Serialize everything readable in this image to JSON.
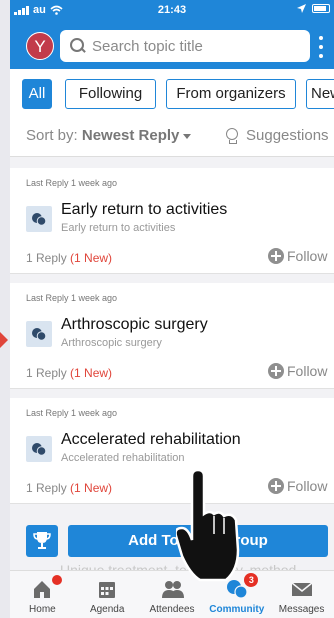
{
  "status": {
    "carrier": "au",
    "time": "21:43"
  },
  "header": {
    "avatar_letter": "Y",
    "search_placeholder": "Search topic title"
  },
  "filters": [
    "All",
    "Following",
    "From organizers",
    "New"
  ],
  "sort": {
    "prefix": "Sort by:",
    "value": "Newest Reply",
    "suggestions": "Suggestions"
  },
  "topics": [
    {
      "meta": "Last Reply 1 week ago",
      "title": "Early return to activities",
      "subtitle": "Early return to activities",
      "replies": "1 Reply",
      "new": "(1 New)",
      "follow": "Follow"
    },
    {
      "meta": "Last Reply 1 week ago",
      "title": "Arthroscopic surgery",
      "subtitle": "Arthroscopic surgery",
      "replies": "1 Reply",
      "new": "(1 New)",
      "follow": "Follow"
    },
    {
      "meta": "Last Reply 1 week ago",
      "title": "Accelerated rehabilitation",
      "subtitle": "Accelerated rehabilitation",
      "replies": "1 Reply",
      "new": "(1 New)",
      "follow": "Follow"
    }
  ],
  "add_bar": {
    "label": "Add Topic to Group",
    "ghost_text": "Unique treatment, technology, method,"
  },
  "nav": {
    "items": [
      {
        "label": "Home",
        "icon": "home-icon"
      },
      {
        "label": "Agenda",
        "icon": "calendar-icon"
      },
      {
        "label": "Attendees",
        "icon": "people-icon"
      },
      {
        "label": "Community",
        "icon": "chat-bubbles-icon"
      },
      {
        "label": "Messages",
        "icon": "mail-icon"
      }
    ],
    "community_badge": "3",
    "active": "Community"
  },
  "colors": {
    "primary": "#1f86d8",
    "accent_red": "#e0453a",
    "avatar": "#c23b4a"
  }
}
